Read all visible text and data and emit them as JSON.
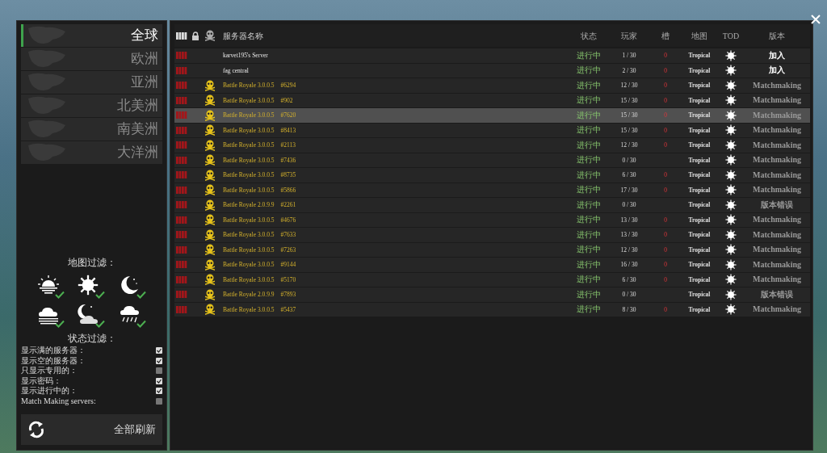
{
  "regions": [
    {
      "label": "全球",
      "selected": true
    },
    {
      "label": "欧洲",
      "selected": false
    },
    {
      "label": "亚洲",
      "selected": false
    },
    {
      "label": "北美洲",
      "selected": false
    },
    {
      "label": "南美洲",
      "selected": false
    },
    {
      "label": "大洋洲",
      "selected": false
    }
  ],
  "map_filter": {
    "title": "地图过滤：",
    "options": [
      {
        "kind": "sunrise",
        "checked": true
      },
      {
        "kind": "sun",
        "checked": true
      },
      {
        "kind": "moon",
        "checked": true
      },
      {
        "kind": "fog",
        "checked": true
      },
      {
        "kind": "cloudy_night",
        "checked": true
      },
      {
        "kind": "rain",
        "checked": true
      }
    ]
  },
  "status_filter": {
    "title": "状态过滤：",
    "options": [
      {
        "label": "显示满的服务器：",
        "checked": true
      },
      {
        "label": "显示空的服务器：",
        "checked": true
      },
      {
        "label": "只显示专用的：",
        "checked": false
      },
      {
        "label": "显示密码：",
        "checked": true
      },
      {
        "label": "显示进行中的：",
        "checked": true
      },
      {
        "label": "Match Making servers:",
        "checked": false
      }
    ]
  },
  "refresh_button": "全部刷新",
  "table": {
    "columns": {
      "name": "服务器名称",
      "status": "状态",
      "players": "玩家",
      "column_4": "槽",
      "map": "地图",
      "tod": "TOD",
      "version": "版本"
    },
    "rows": [
      {
        "kind": "custom",
        "name": "karvet195's Server",
        "number": "",
        "status": "进行中",
        "players": "1 / 30",
        "column_4": "0",
        "map": "Tropical",
        "version": "加入",
        "selected": false
      },
      {
        "kind": "custom",
        "name": "fag central",
        "number": "",
        "status": "进行中",
        "players": "2 / 30",
        "column_4": "0",
        "map": "Tropical",
        "version": "加入",
        "selected": false
      },
      {
        "kind": "matchmaking",
        "name": "Battle Royale 3.0.0.5",
        "number": "#6294",
        "status": "进行中",
        "players": "12 / 30",
        "column_4": "0",
        "map": "Tropical",
        "version": "Matchmaking",
        "selected": false
      },
      {
        "kind": "matchmaking",
        "name": "Battle Royale 3.0.0.5",
        "number": "#902",
        "status": "进行中",
        "players": "15 / 30",
        "column_4": "0",
        "map": "Tropical",
        "version": "Matchmaking",
        "selected": false
      },
      {
        "kind": "matchmaking",
        "name": "Battle Royale 3.0.0.5",
        "number": "#7620",
        "status": "进行中",
        "players": "15 / 30",
        "column_4": "0",
        "map": "Tropical",
        "version": "Matchmaking",
        "selected": true
      },
      {
        "kind": "matchmaking",
        "name": "Battle Royale 3.0.0.5",
        "number": "#8413",
        "status": "进行中",
        "players": "15 / 30",
        "column_4": "0",
        "map": "Tropical",
        "version": "Matchmaking",
        "selected": false
      },
      {
        "kind": "matchmaking",
        "name": "Battle Royale 3.0.0.5",
        "number": "#2113",
        "status": "进行中",
        "players": "12 / 30",
        "column_4": "0",
        "map": "Tropical",
        "version": "Matchmaking",
        "selected": false
      },
      {
        "kind": "matchmaking",
        "name": "Battle Royale 3.0.0.5",
        "number": "#7436",
        "status": "进行中",
        "players": "0 / 30",
        "map": "Tropical",
        "version": "Matchmaking",
        "selected": false
      },
      {
        "kind": "matchmaking",
        "name": "Battle Royale 3.0.0.5",
        "number": "#8735",
        "status": "进行中",
        "players": "6 / 30",
        "column_4": "0",
        "map": "Tropical",
        "version": "Matchmaking",
        "selected": false
      },
      {
        "kind": "matchmaking",
        "name": "Battle Royale 3.0.0.5",
        "number": "#5866",
        "status": "进行中",
        "players": "17 / 30",
        "column_4": "0",
        "map": "Tropical",
        "version": "Matchmaking",
        "selected": false
      },
      {
        "kind": "matchmaking",
        "name": "Battle Royale 2.0.9.9",
        "number": "#2261",
        "status": "进行中",
        "players": "0 / 30",
        "map": "Tropical",
        "version": "版本错误",
        "selected": false
      },
      {
        "kind": "matchmaking",
        "name": "Battle Royale 3.0.0.5",
        "number": "#4676",
        "status": "进行中",
        "players": "13 / 30",
        "column_4": "0",
        "map": "Tropical",
        "version": "Matchmaking",
        "selected": false
      },
      {
        "kind": "matchmaking",
        "name": "Battle Royale 3.0.0.5",
        "number": "#7633",
        "status": "进行中",
        "players": "13 / 30",
        "column_4": "0",
        "map": "Tropical",
        "version": "Matchmaking",
        "selected": false
      },
      {
        "kind": "matchmaking",
        "name": "Battle Royale 3.0.0.5",
        "number": "#7263",
        "status": "进行中",
        "players": "12 / 30",
        "column_4": "0",
        "map": "Tropical",
        "version": "Matchmaking",
        "selected": false
      },
      {
        "kind": "matchmaking",
        "name": "Battle Royale 3.0.0.5",
        "number": "#9144",
        "status": "进行中",
        "players": "16 / 30",
        "column_4": "0",
        "map": "Tropical",
        "version": "Matchmaking",
        "selected": false
      },
      {
        "kind": "matchmaking",
        "name": "Battle Royale 3.0.0.5",
        "number": "#5170",
        "status": "进行中",
        "players": "6 / 30",
        "column_4": "0",
        "map": "Tropical",
        "version": "Matchmaking",
        "selected": false
      },
      {
        "kind": "matchmaking",
        "name": "Battle Royale 2.0.9.9",
        "number": "#7893",
        "status": "进行中",
        "players": "0 / 30",
        "map": "Tropical",
        "version": "版本错误",
        "selected": false
      },
      {
        "kind": "matchmaking",
        "name": "Battle Royale 3.0.0.5",
        "number": "#5437",
        "status": "进行中",
        "players": "8 / 30",
        "column_4": "0",
        "map": "Tropical",
        "version": "Matchmaking",
        "selected": false
      }
    ]
  }
}
